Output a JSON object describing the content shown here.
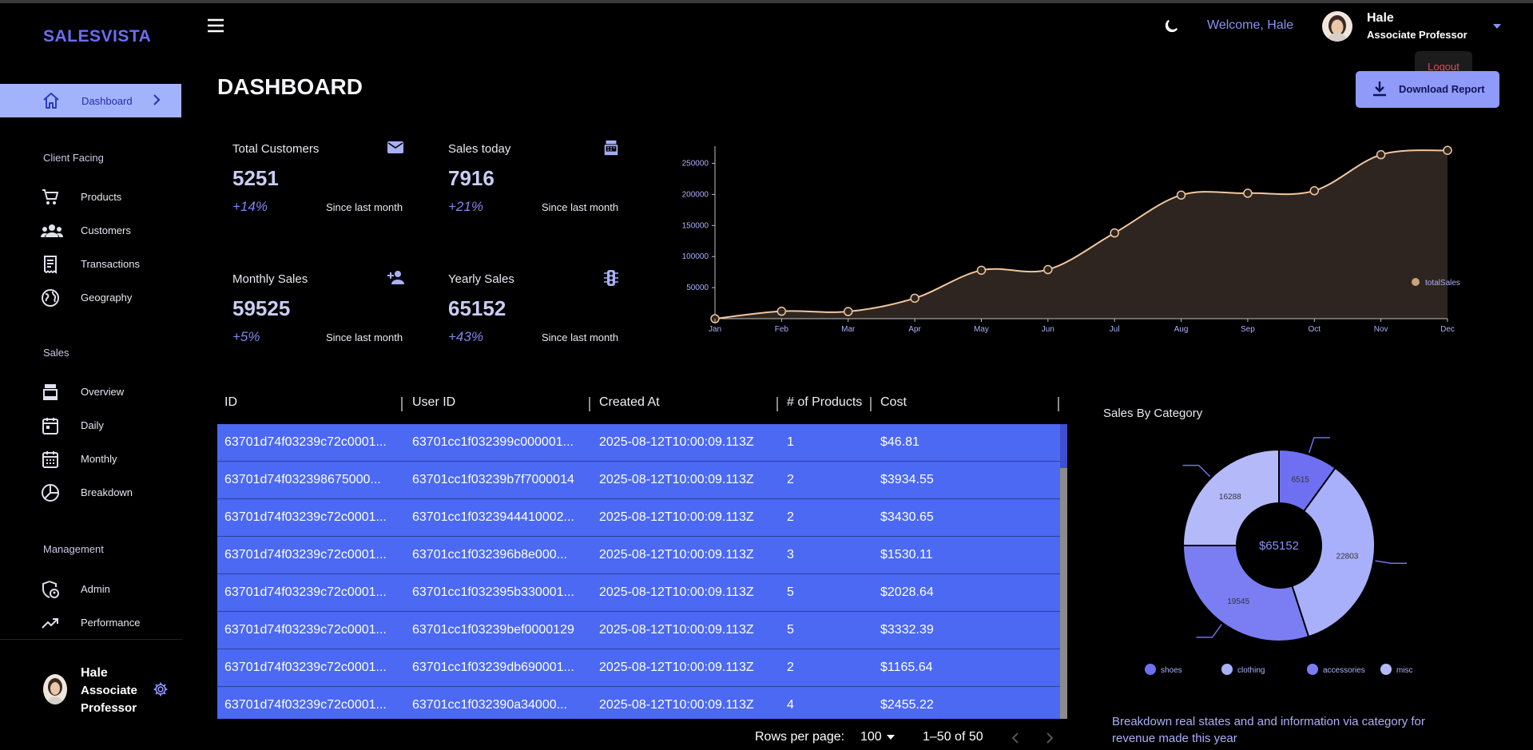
{
  "app": {
    "brand": "SALESVISTA"
  },
  "sidebar": {
    "active": {
      "label": "Dashboard",
      "icon": "home-icon"
    },
    "sections": [
      {
        "title": "Client Facing",
        "items": [
          {
            "label": "Products",
            "icon": "cart-icon"
          },
          {
            "label": "Customers",
            "icon": "people-icon"
          },
          {
            "label": "Transactions",
            "icon": "receipt-icon"
          },
          {
            "label": "Geography",
            "icon": "globe-icon"
          }
        ]
      },
      {
        "title": "Sales",
        "items": [
          {
            "label": "Overview",
            "icon": "point-of-sale-icon"
          },
          {
            "label": "Daily",
            "icon": "calendar-today-icon"
          },
          {
            "label": "Monthly",
            "icon": "calendar-month-icon"
          },
          {
            "label": "Breakdown",
            "icon": "pie-chart-icon"
          }
        ]
      },
      {
        "title": "Management",
        "items": [
          {
            "label": "Admin",
            "icon": "admin-icon"
          },
          {
            "label": "Performance",
            "icon": "trending-up-icon"
          }
        ]
      }
    ],
    "profile": {
      "name": "Hale",
      "role": "Associate Professor"
    }
  },
  "header": {
    "welcome": "Welcome, Hale",
    "user_name": "Hale",
    "user_role": "Associate Professor",
    "logout": "Logout",
    "download_label": "Download Report"
  },
  "page": {
    "title": "DASHBOARD"
  },
  "stats": [
    {
      "title": "Total Customers",
      "value": "5251",
      "pct": "+14%",
      "since": "Since last month",
      "icon": "email-icon"
    },
    {
      "title": "Sales today",
      "value": "7916",
      "pct": "+21%",
      "since": "Since last month",
      "icon": "point-of-sale-icon"
    },
    {
      "title": "Monthly Sales",
      "value": "59525",
      "pct": "+5%",
      "since": "Since last month",
      "icon": "person-add-icon"
    },
    {
      "title": "Yearly Sales",
      "value": "65152",
      "pct": "+43%",
      "since": "Since last month",
      "icon": "traffic-icon"
    }
  ],
  "chart_data": [
    {
      "type": "area",
      "title": "",
      "xlabel": "",
      "ylabel": "",
      "categories": [
        "Jan",
        "Feb",
        "Mar",
        "Apr",
        "May",
        "Jun",
        "Jul",
        "Aug",
        "Sep",
        "Oct",
        "Nov",
        "Dec"
      ],
      "series": [
        {
          "name": "totalSales",
          "values": [
            0,
            12000,
            11500,
            33000,
            78000,
            79000,
            138000,
            199000,
            202000,
            206000,
            264000,
            271000
          ]
        }
      ],
      "yticks": [
        50000,
        100000,
        150000,
        200000,
        250000
      ],
      "ylim": [
        0,
        270000
      ],
      "legend": "right",
      "grid": false,
      "colors": {
        "line": "#f0c7a0",
        "fill": "#2e2520"
      }
    },
    {
      "type": "pie",
      "title": "Sales By Category",
      "center_label": "$65152",
      "slices": [
        {
          "name": "shoes",
          "value": 6515,
          "color": "#6f6ff2"
        },
        {
          "name": "clothing",
          "value": 22803,
          "color": "#a9b0fb"
        },
        {
          "name": "accessories",
          "value": 19545,
          "color": "#7b7ef3"
        },
        {
          "name": "misc",
          "value": 16288,
          "color": "#b4baf9"
        }
      ],
      "legend": "bottom"
    }
  ],
  "table": {
    "columns": [
      "ID",
      "User ID",
      "Created At",
      "# of Products",
      "Cost"
    ],
    "rows": [
      [
        "63701d74f03239c72c0001...",
        "63701cc1f032399c000001...",
        "2025-08-12T10:00:09.113Z",
        "1",
        "$46.81"
      ],
      [
        "63701d74f032398675000...",
        "63701cc1f03239b7f7000014",
        "2025-08-12T10:00:09.113Z",
        "2",
        "$3934.55"
      ],
      [
        "63701d74f03239c72c0001...",
        "63701cc1f0323944410002...",
        "2025-08-12T10:00:09.113Z",
        "2",
        "$3430.65"
      ],
      [
        "63701d74f03239c72c0001...",
        "63701cc1f032396b8e000...",
        "2025-08-12T10:00:09.113Z",
        "3",
        "$1530.11"
      ],
      [
        "63701d74f03239c72c0001...",
        "63701cc1f032395b330001...",
        "2025-08-12T10:00:09.113Z",
        "5",
        "$2028.64"
      ],
      [
        "63701d74f03239c72c0001...",
        "63701cc1f03239bef0000129",
        "2025-08-12T10:00:09.113Z",
        "5",
        "$3332.39"
      ],
      [
        "63701d74f03239c72c0001...",
        "63701cc1f03239db690001...",
        "2025-08-12T10:00:09.113Z",
        "2",
        "$1165.64"
      ],
      [
        "63701d74f03239c72c0001...",
        "63701cc1f032390a34000...",
        "2025-08-12T10:00:09.113Z",
        "4",
        "$2455.22"
      ]
    ],
    "pagination": {
      "rows_per_page_label": "Rows per page:",
      "rows_per_page": "100",
      "range": "1–50 of 50"
    }
  },
  "breakdown": {
    "description": "Breakdown real states and and information via category for revenue made this year"
  }
}
